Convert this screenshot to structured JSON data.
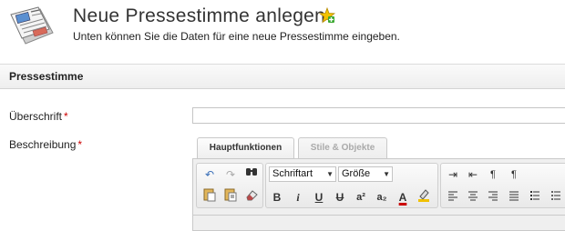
{
  "header": {
    "title": "Neue Pressestimme anlegen",
    "subtitle": "Unten können Sie die Daten für eine neue Pressestimme eingeben.",
    "icon": "newspaper-icon",
    "add_icon": "add-star-icon"
  },
  "section": {
    "title": "Pressestimme"
  },
  "form": {
    "ueberschrift": {
      "label": "Überschrift",
      "required": "*",
      "value": ""
    },
    "beschreibung": {
      "label": "Beschreibung",
      "required": "*"
    }
  },
  "editor": {
    "tabs": [
      {
        "label": "Hauptfunktionen",
        "active": true
      },
      {
        "label": "Stile & Objekte",
        "active": false
      }
    ],
    "font_select": "Schriftart",
    "size_select": "Größe",
    "buttons": {
      "bold": "B",
      "italic": "i",
      "underline": "U",
      "strike": "U",
      "sup": "a²",
      "sub": "a₂",
      "color": "A"
    }
  },
  "colors": {
    "required": "#cc0000",
    "add_icon": "#e8b400"
  }
}
